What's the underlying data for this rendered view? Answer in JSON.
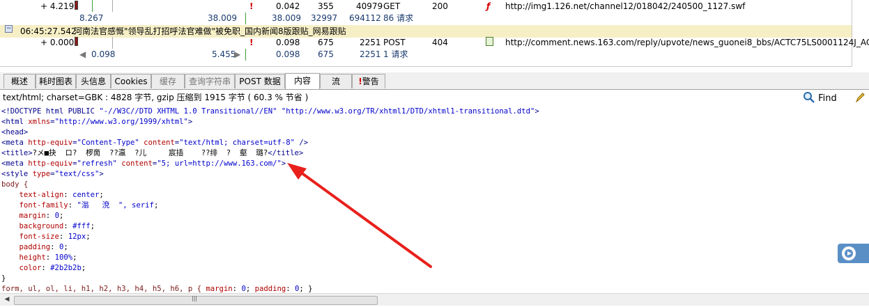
{
  "grid": {
    "rows": [
      {
        "kind": "main",
        "delta": "+ 4.219",
        "c1": "0.042",
        "c2": "355",
        "c3": "40979",
        "method": "GET",
        "status": "200",
        "url": "http://img1.126.net/channel12/018042/240500_1127.swf"
      },
      {
        "kind": "sub",
        "left": "8.267",
        "mid": "38.009",
        "c1": "38.009",
        "c2": "32997",
        "c3": "694112",
        "req": "86 请求"
      },
      {
        "kind": "header",
        "time": "06:45:27.542",
        "title": "河南法官感慨\"领导乱打招呼法官难做\"被免职_国内新闻8版跟贴_网易跟贴"
      },
      {
        "kind": "main",
        "delta": "+ 0.000",
        "c1": "0.098",
        "c2": "675",
        "c3": "2251",
        "method": "POST",
        "status": "404",
        "url": "http://comment.news.163.com/reply/upvote/news_guonei8_bbs/ACTC75LS0001124J_ACUUJBVE"
      },
      {
        "kind": "sub",
        "left": "0.098",
        "mid": "5.455",
        "c1": "0.098",
        "c2": "675",
        "c3": "2251",
        "req": "1 请求"
      }
    ]
  },
  "tabs": [
    "概述",
    "耗时图表",
    "头信息",
    "Cookies",
    "缓存",
    "查询字符串",
    "POST 数据",
    "内容",
    "流",
    "警告"
  ],
  "active_tab": "内容",
  "info": "text/html; charset=GBK : 4828 字节, gzip 压缩到 1915 字节 ( 60.3 % 节省 )",
  "find_label": "Find",
  "code": {
    "l1a": "<!DOCTYPE html PUBLIC ",
    "l1b": "\"-//W3C//DTD XHTML 1.0 Transitional//EN\"",
    "l1c": " ",
    "l1d": "\"http://www.w3.org/TR/xhtml1/DTD/xhtml1-transitional.dtd\"",
    "l1e": ">",
    "l2a": "<html ",
    "l2b": "xmlns",
    "l2c": "=",
    "l2d": "\"http://www.w3.org/1999/xhtml\"",
    "l2e": ">",
    "l3": "<head>",
    "l4a": "<meta ",
    "l4b": "http-equiv",
    "l4c": "=",
    "l4d": "\"Content-Type\"",
    "l4e": " content",
    "l4f": "=",
    "l4g": "\"text/html; charset=utf-8\"",
    "l4h": " />",
    "l5a": "<title>",
    "l5b": "?メ■抉  ロ?  椤啇  ??瀛  ?儿     宸插    ??绯  ?  壑  璐?",
    "l5c": "</title>",
    "l6a": "<meta ",
    "l6b": "http-equiv",
    "l6c": "=",
    "l6d": "\"refresh\"",
    "l6e": " content",
    "l6f": "=",
    "l6g": "\"5; url=http://www.163.com/\"",
    "l6h": ">",
    "l7a": "<style ",
    "l7b": "type",
    "l7c": "=",
    "l7d": "\"text/css\"",
    "l7e": ">",
    "l8": "body {",
    "props": [
      {
        "k": "text-align",
        "v": "center"
      },
      {
        "k": "font-family",
        "v": "\"滃   渷  \", serif"
      },
      {
        "k": "margin",
        "v": "0"
      },
      {
        "k": "background",
        "v": "#fff"
      },
      {
        "k": "font-size",
        "v": "12px"
      },
      {
        "k": "padding",
        "v": "0"
      },
      {
        "k": "height",
        "v": "100%"
      },
      {
        "k": "color",
        "v": "#2b2b2b"
      }
    ],
    "l17": "}",
    "l18a": "form, ul, ol, li, h1, h2, h3, h4, h5, h6, p { ",
    "l18b": "margin",
    "l18c": ": ",
    "l18d": "0",
    "l18e": "; ",
    "l18f": "padding",
    "l18g": ": ",
    "l18h": "0",
    "l18i": "; }"
  }
}
